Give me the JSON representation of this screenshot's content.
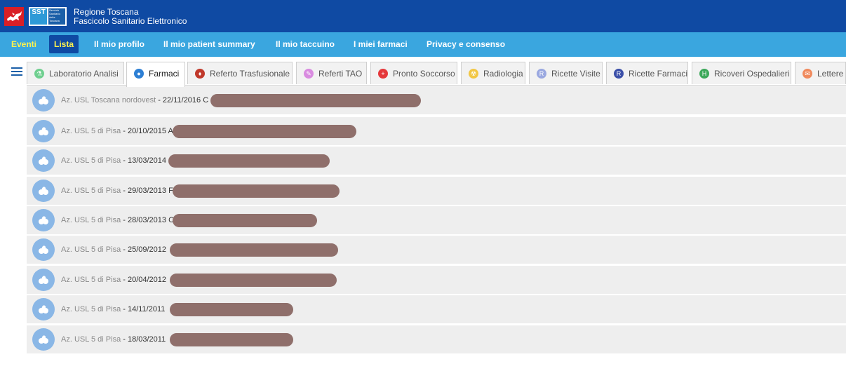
{
  "header": {
    "title_line1": "Regione Toscana",
    "title_line2": "Fascicolo Sanitario Elettronico",
    "sst_logo_text": "SST",
    "sst_logo_subtext": "Servizio Sanitario della Toscana",
    "background_color": "#0f4aa3"
  },
  "nav": {
    "items": [
      {
        "label": "Eventi"
      },
      {
        "label": "Lista"
      },
      {
        "label": "Il mio profilo"
      },
      {
        "label": "Il mio patient summary"
      },
      {
        "label": "Il mio taccuino"
      },
      {
        "label": "I miei farmaci"
      },
      {
        "label": "Privacy e consenso"
      }
    ],
    "active": "Lista",
    "background_color": "#3aa6df",
    "highlight_color": "#fff34d"
  },
  "menu_icon": "hamburger-icon",
  "tabs": [
    {
      "label": "Laboratorio Analisi",
      "icon": "flask-icon",
      "color": "#6fcf8f"
    },
    {
      "label": "Farmaci",
      "icon": "pill-icon",
      "color": "#2d7fd4"
    },
    {
      "label": "Referto Trasfusionale",
      "icon": "blood-drop-icon",
      "color": "#c0392b"
    },
    {
      "label": "Referti TAO",
      "icon": "syringe-icon",
      "color": "#d98be0"
    },
    {
      "label": "Pronto Soccorso",
      "icon": "cross-icon",
      "color": "#e5383b"
    },
    {
      "label": "Radiologia",
      "icon": "radiation-icon",
      "color": "#f2c744"
    },
    {
      "label": "Ricette Visite",
      "icon": "prescription-icon",
      "color": "#9aa8e0"
    },
    {
      "label": "Ricette Farmaci",
      "icon": "prescription-icon",
      "color": "#3b4fa8"
    },
    {
      "label": "Ricoveri Ospedalieri",
      "icon": "hospital-icon",
      "color": "#3ca85a"
    },
    {
      "label": "Lettere",
      "icon": "letter-icon",
      "color": "#f08a5d"
    }
  ],
  "active_tab": "Farmaci",
  "entries": [
    {
      "org": "Az. USL Toscana nordovest",
      "date": "22/11/2016",
      "visible_snippet": "C",
      "icon": "pill-icon"
    },
    {
      "org": "Az. USL 5 di Pisa",
      "date": "20/10/2015",
      "visible_snippet": "A",
      "icon": "pill-icon"
    },
    {
      "org": "Az. USL 5 di Pisa",
      "date": "13/03/2014",
      "visible_snippet": "",
      "icon": "pill-icon"
    },
    {
      "org": "Az. USL 5 di Pisa",
      "date": "29/03/2013",
      "visible_snippet": "F",
      "icon": "pill-icon"
    },
    {
      "org": "Az. USL 5 di Pisa",
      "date": "28/03/2013",
      "visible_snippet": "C",
      "icon": "pill-icon"
    },
    {
      "org": "Az. USL 5 di Pisa",
      "date": "25/09/2012",
      "visible_snippet": "",
      "icon": "pill-icon"
    },
    {
      "org": "Az. USL 5 di Pisa",
      "date": "20/04/2012",
      "visible_snippet": "",
      "icon": "pill-icon"
    },
    {
      "org": "Az. USL 5 di Pisa",
      "date": "14/11/2011",
      "visible_snippet": "",
      "icon": "pill-icon"
    },
    {
      "org": "Az. USL 5 di Pisa",
      "date": "18/03/2011",
      "visible_snippet": "",
      "icon": "pill-icon"
    }
  ],
  "date_separator": " - "
}
